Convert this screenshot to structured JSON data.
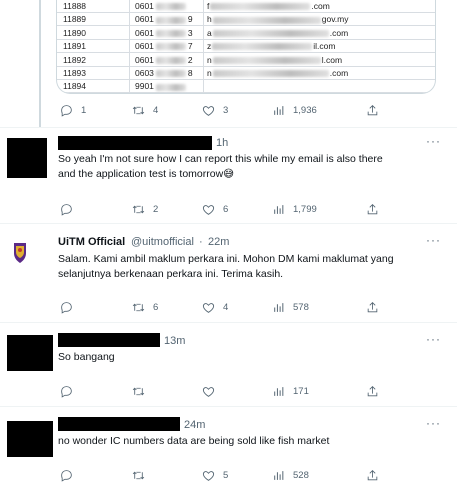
{
  "sheet": {
    "rows": [
      {
        "id": "11888",
        "ic": "0601",
        "icend": "",
        "email_start": "f",
        "email_end": ".com"
      },
      {
        "id": "11889",
        "ic": "0601",
        "icend": "9",
        "email_start": "h",
        "email_end": "gov.my"
      },
      {
        "id": "11890",
        "ic": "0601",
        "icend": "3",
        "email_start": "a",
        "email_end": ".com"
      },
      {
        "id": "11891",
        "ic": "0601",
        "icend": "7",
        "email_start": "z",
        "email_end": "il.com"
      },
      {
        "id": "11892",
        "ic": "0601",
        "icend": "2",
        "email_start": "n",
        "email_end": "l.com"
      },
      {
        "id": "11893",
        "ic": "0603",
        "icend": "8",
        "email_start": "n",
        "email_end": ".com"
      },
      {
        "id": "11894",
        "ic": "9901",
        "icend": "",
        "email_start": "",
        "email_end": ""
      }
    ]
  },
  "tweets": [
    {
      "stats": {
        "replies": "1",
        "retweets": "4",
        "likes": "3",
        "views": "1,936"
      }
    },
    {
      "time": "1h",
      "text_line1": "So yeah I'm not sure how I can report this while my email is also there",
      "text_line2": "and the application test is tomorrow😅",
      "stats": {
        "replies": "",
        "retweets": "2",
        "likes": "6",
        "views": "1,799"
      }
    },
    {
      "name": "UiTM Official",
      "handle": "@uitmofficial",
      "time": "22m",
      "text_line1": "Salam. Kami ambil maklum perkara ini. Mohon DM kami maklumat yang",
      "text_line2": "selanjutnya berkenaan perkara ini. Terima kasih.",
      "stats": {
        "replies": "",
        "retweets": "6",
        "likes": "4",
        "views": "578"
      }
    },
    {
      "time": "13m",
      "text_line1": "So bangang",
      "stats": {
        "replies": "",
        "retweets": "",
        "likes": "",
        "views": "171"
      }
    },
    {
      "time": "24m",
      "text_line1": "no wonder IC numbers data are being sold like fish market",
      "stats": {
        "replies": "",
        "retweets": "",
        "likes": "5",
        "views": "528"
      }
    }
  ],
  "more_glyph": "···",
  "separator": "·",
  "icons": {
    "reply": "reply-icon",
    "retweet": "retweet-icon",
    "like": "like-icon",
    "views": "views-icon",
    "share": "share-icon",
    "more": "more-icon"
  },
  "colors": {
    "text": "#0f1419",
    "muted": "#536471",
    "border": "#eff3f4",
    "redaction": "#000000"
  }
}
